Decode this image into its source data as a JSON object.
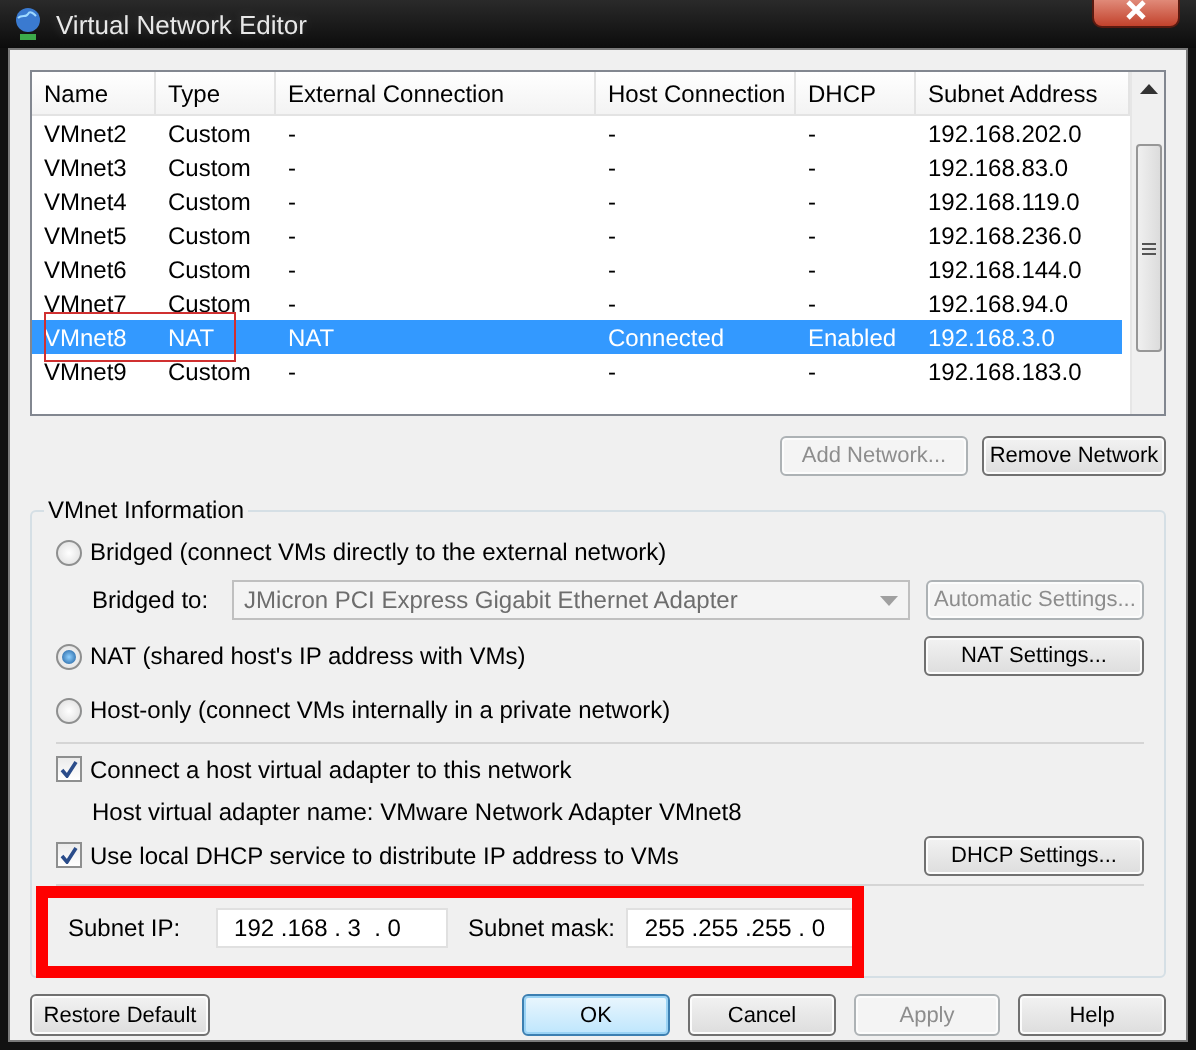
{
  "window": {
    "title": "Virtual Network Editor"
  },
  "table": {
    "columns": [
      "Name",
      "Type",
      "External Connection",
      "Host Connection",
      "DHCP",
      "Subnet Address"
    ],
    "rows": [
      {
        "cells": [
          "VMnet2",
          "Custom",
          "-",
          "-",
          "-",
          "192.168.202.0"
        ],
        "selected": false
      },
      {
        "cells": [
          "VMnet3",
          "Custom",
          "-",
          "-",
          "-",
          "192.168.83.0"
        ],
        "selected": false
      },
      {
        "cells": [
          "VMnet4",
          "Custom",
          "-",
          "-",
          "-",
          "192.168.119.0"
        ],
        "selected": false
      },
      {
        "cells": [
          "VMnet5",
          "Custom",
          "-",
          "-",
          "-",
          "192.168.236.0"
        ],
        "selected": false
      },
      {
        "cells": [
          "VMnet6",
          "Custom",
          "-",
          "-",
          "-",
          "192.168.144.0"
        ],
        "selected": false
      },
      {
        "cells": [
          "VMnet7",
          "Custom",
          "-",
          "-",
          "-",
          "192.168.94.0"
        ],
        "selected": false
      },
      {
        "cells": [
          "VMnet8",
          "NAT",
          "NAT",
          "Connected",
          "Enabled",
          "192.168.3.0"
        ],
        "selected": true
      },
      {
        "cells": [
          "VMnet9",
          "Custom",
          "-",
          "-",
          "-",
          "192.168.183.0"
        ],
        "selected": false
      }
    ]
  },
  "network_buttons": [
    {
      "label": "Add Network...",
      "disabled": true
    },
    {
      "label": "Remove Network",
      "disabled": false
    }
  ],
  "vmnet_info": {
    "title": "VMnet Information",
    "modes": [
      {
        "label": "Bridged (connect VMs directly to the external network)",
        "selected": false
      },
      {
        "label": "NAT (shared host's IP address with VMs)",
        "selected": true
      },
      {
        "label": "Host-only (connect VMs internally in a private network)",
        "selected": false
      }
    ],
    "bridged_to": {
      "label": "Bridged to:",
      "value": "JMicron PCI Express Gigabit Ethernet Adapter",
      "disabled": true
    },
    "automatic_settings": {
      "label": "Automatic Settings...",
      "disabled": true
    },
    "nat_settings": {
      "label": "NAT Settings...",
      "disabled": false
    },
    "connect_adapter": {
      "label": "Connect a host virtual adapter to this network",
      "checked": true
    },
    "adapter_name": "Host virtual adapter name: VMware Network Adapter VMnet8",
    "use_dhcp": {
      "label": "Use local DHCP service to distribute IP address to VMs",
      "checked": true
    },
    "dhcp_settings": {
      "label": "DHCP Settings...",
      "disabled": false
    },
    "subnet_ip": {
      "label": "Subnet IP:",
      "value": "192 .168 . 3  . 0"
    },
    "subnet_mask": {
      "label": "Subnet mask:",
      "value": "255 .255 .255 . 0"
    }
  },
  "footer_buttons": [
    {
      "label": "Restore Default",
      "disabled": false,
      "default": false
    },
    {
      "label": "OK",
      "disabled": false,
      "default": true
    },
    {
      "label": "Cancel",
      "disabled": false,
      "default": false
    },
    {
      "label": "Apply",
      "disabled": true,
      "default": false
    },
    {
      "label": "Help",
      "disabled": false,
      "default": false
    }
  ]
}
